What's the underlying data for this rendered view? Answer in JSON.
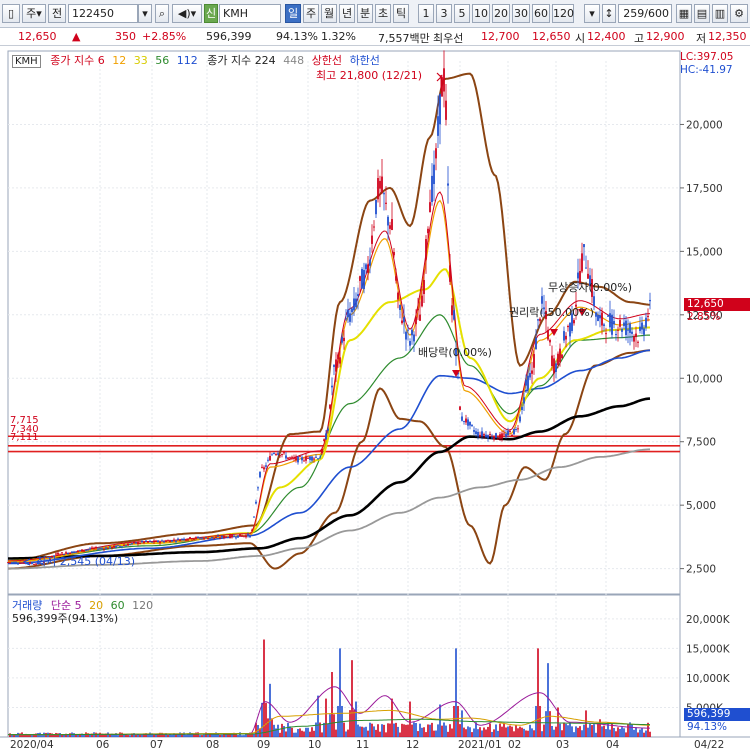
{
  "toolbar": {
    "market_label": "주",
    "prev_label": "전",
    "code": "122450",
    "kind_badge": "신",
    "name": "KMH",
    "periods": [
      "일",
      "주",
      "월",
      "년",
      "분",
      "초",
      "틱"
    ],
    "numbers": [
      "1",
      "3",
      "5",
      "10",
      "20",
      "30",
      "60",
      "120"
    ],
    "count": "259",
    "max_count": "/600"
  },
  "quote": {
    "price": "12,650",
    "change": "350",
    "rate": "+2.85%",
    "volume": "596,399",
    "vol_ratio": "94.13%",
    "turnover": "1.32%",
    "amount": "7,557백만",
    "best_label": "최우선",
    "ask": "12,700",
    "bid": "12,650",
    "open_label": "시",
    "open": "12,400",
    "high_label": "고",
    "high": "12,900",
    "low_label": "저",
    "low": "12,350"
  },
  "price_pane": {
    "name_tag": "KMH",
    "legend_ma_label": "종가 지수",
    "ma_periods": [
      "6",
      "12",
      "33",
      "56",
      "112"
    ],
    "legend_ma2_label": "종가 지수",
    "ma2_periods": [
      "224",
      "448"
    ],
    "limit_labels": [
      "상한선",
      "하한선"
    ],
    "lc": "LC:397.05",
    "hc": "HC:-41.97",
    "high_note": "최고 21,800 (12/21)",
    "low_note": "최저 2,545 (04/13)",
    "annotations": [
      "무상증자(0.00%)",
      "권리락(-50.00%)",
      "배당락(0.00%)"
    ],
    "current_price": "12,650",
    "current_rate": "2.85%",
    "hlines": [
      "7,715",
      "7,340",
      "7,111"
    ],
    "y_ticks": [
      "20,000",
      "17,500",
      "15,000",
      "12,500",
      "10,000",
      "7,500",
      "5,000",
      "2,500"
    ]
  },
  "volume_pane": {
    "label": "거래량",
    "legend_label": "단순",
    "ma_periods": [
      "5",
      "20",
      "60",
      "120"
    ],
    "value_line": "596,399주(94.13%)",
    "current_value": "596,399",
    "current_rate": "94.13%",
    "y_ticks": [
      "20,000K",
      "15,000K",
      "10,000K",
      "5,000K"
    ]
  },
  "x_axis": [
    "2020/04",
    "06",
    "07",
    "08",
    "09",
    "10",
    "11",
    "12",
    "2021/01",
    "02",
    "03",
    "04",
    "04/22"
  ],
  "colors": {
    "up": "#d0021b",
    "down": "#1f4fd0",
    "ma6": "#d0021b",
    "ma12": "#f0a000",
    "ma33": "#e5e000",
    "ma56": "#2e8b2e",
    "ma112": "#1f4fd0",
    "ma224": "#000000",
    "ma448": "#999999",
    "band": "#8b4513"
  },
  "chart_data": {
    "type": "line",
    "x": [
      "2020-04",
      "2020-05",
      "2020-06",
      "2020-07",
      "2020-08",
      "2020-09",
      "2020-10",
      "2020-11",
      "2020-12",
      "2021-01",
      "2021-02",
      "2021-03",
      "2021-04"
    ],
    "series": [
      {
        "name": "종가",
        "values": [
          2700,
          3400,
          3600,
          3800,
          4200,
          7200,
          7000,
          17500,
          19000,
          7700,
          8200,
          13000,
          12650
        ]
      },
      {
        "name": "224",
        "values": [
          2900,
          3100,
          3200,
          3300,
          3400,
          3900,
          4600,
          5800,
          7100,
          7700,
          8000,
          8600,
          9200
        ]
      },
      {
        "name": "448",
        "values": [
          2400,
          2500,
          2600,
          2700,
          2900,
          3200,
          3600,
          4300,
          5200,
          6000,
          6500,
          6900,
          7200
        ]
      }
    ],
    "ylim": [
      1500,
      22500
    ]
  }
}
